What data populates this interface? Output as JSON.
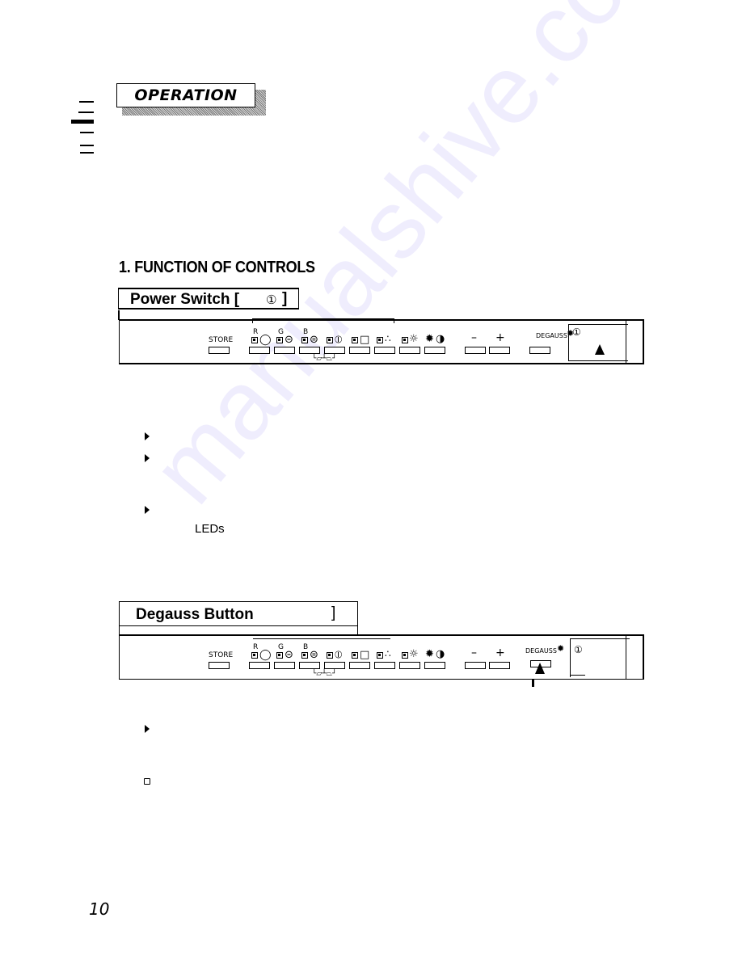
{
  "banner": {
    "title": "OPERATION"
  },
  "section": {
    "heading": "1. FUNCTION OF CONTROLS"
  },
  "power_switch": {
    "title": "Power  Switch  [",
    "symbol": "①",
    "close": "]",
    "bullets": [
      "",
      "",
      ""
    ],
    "note_fragment": "LEDs"
  },
  "degauss": {
    "title": "Degauss Button",
    "close": "]",
    "bullets": [
      ""
    ],
    "note": ""
  },
  "panel": {
    "store_label": "STORE",
    "color_labels": [
      "R",
      "G",
      "B"
    ],
    "minus_label": "–",
    "plus_label": "+",
    "degauss_label": "DEGAUSS",
    "power_symbol": "①",
    "icons": [
      "size-icon",
      "width-icon",
      "height-icon",
      "pincushion-icon",
      "position-icon",
      "convergence-icon",
      "brightness-icon",
      "contrast-icon"
    ]
  },
  "watermark": "manualshive.com",
  "page_number": "10"
}
